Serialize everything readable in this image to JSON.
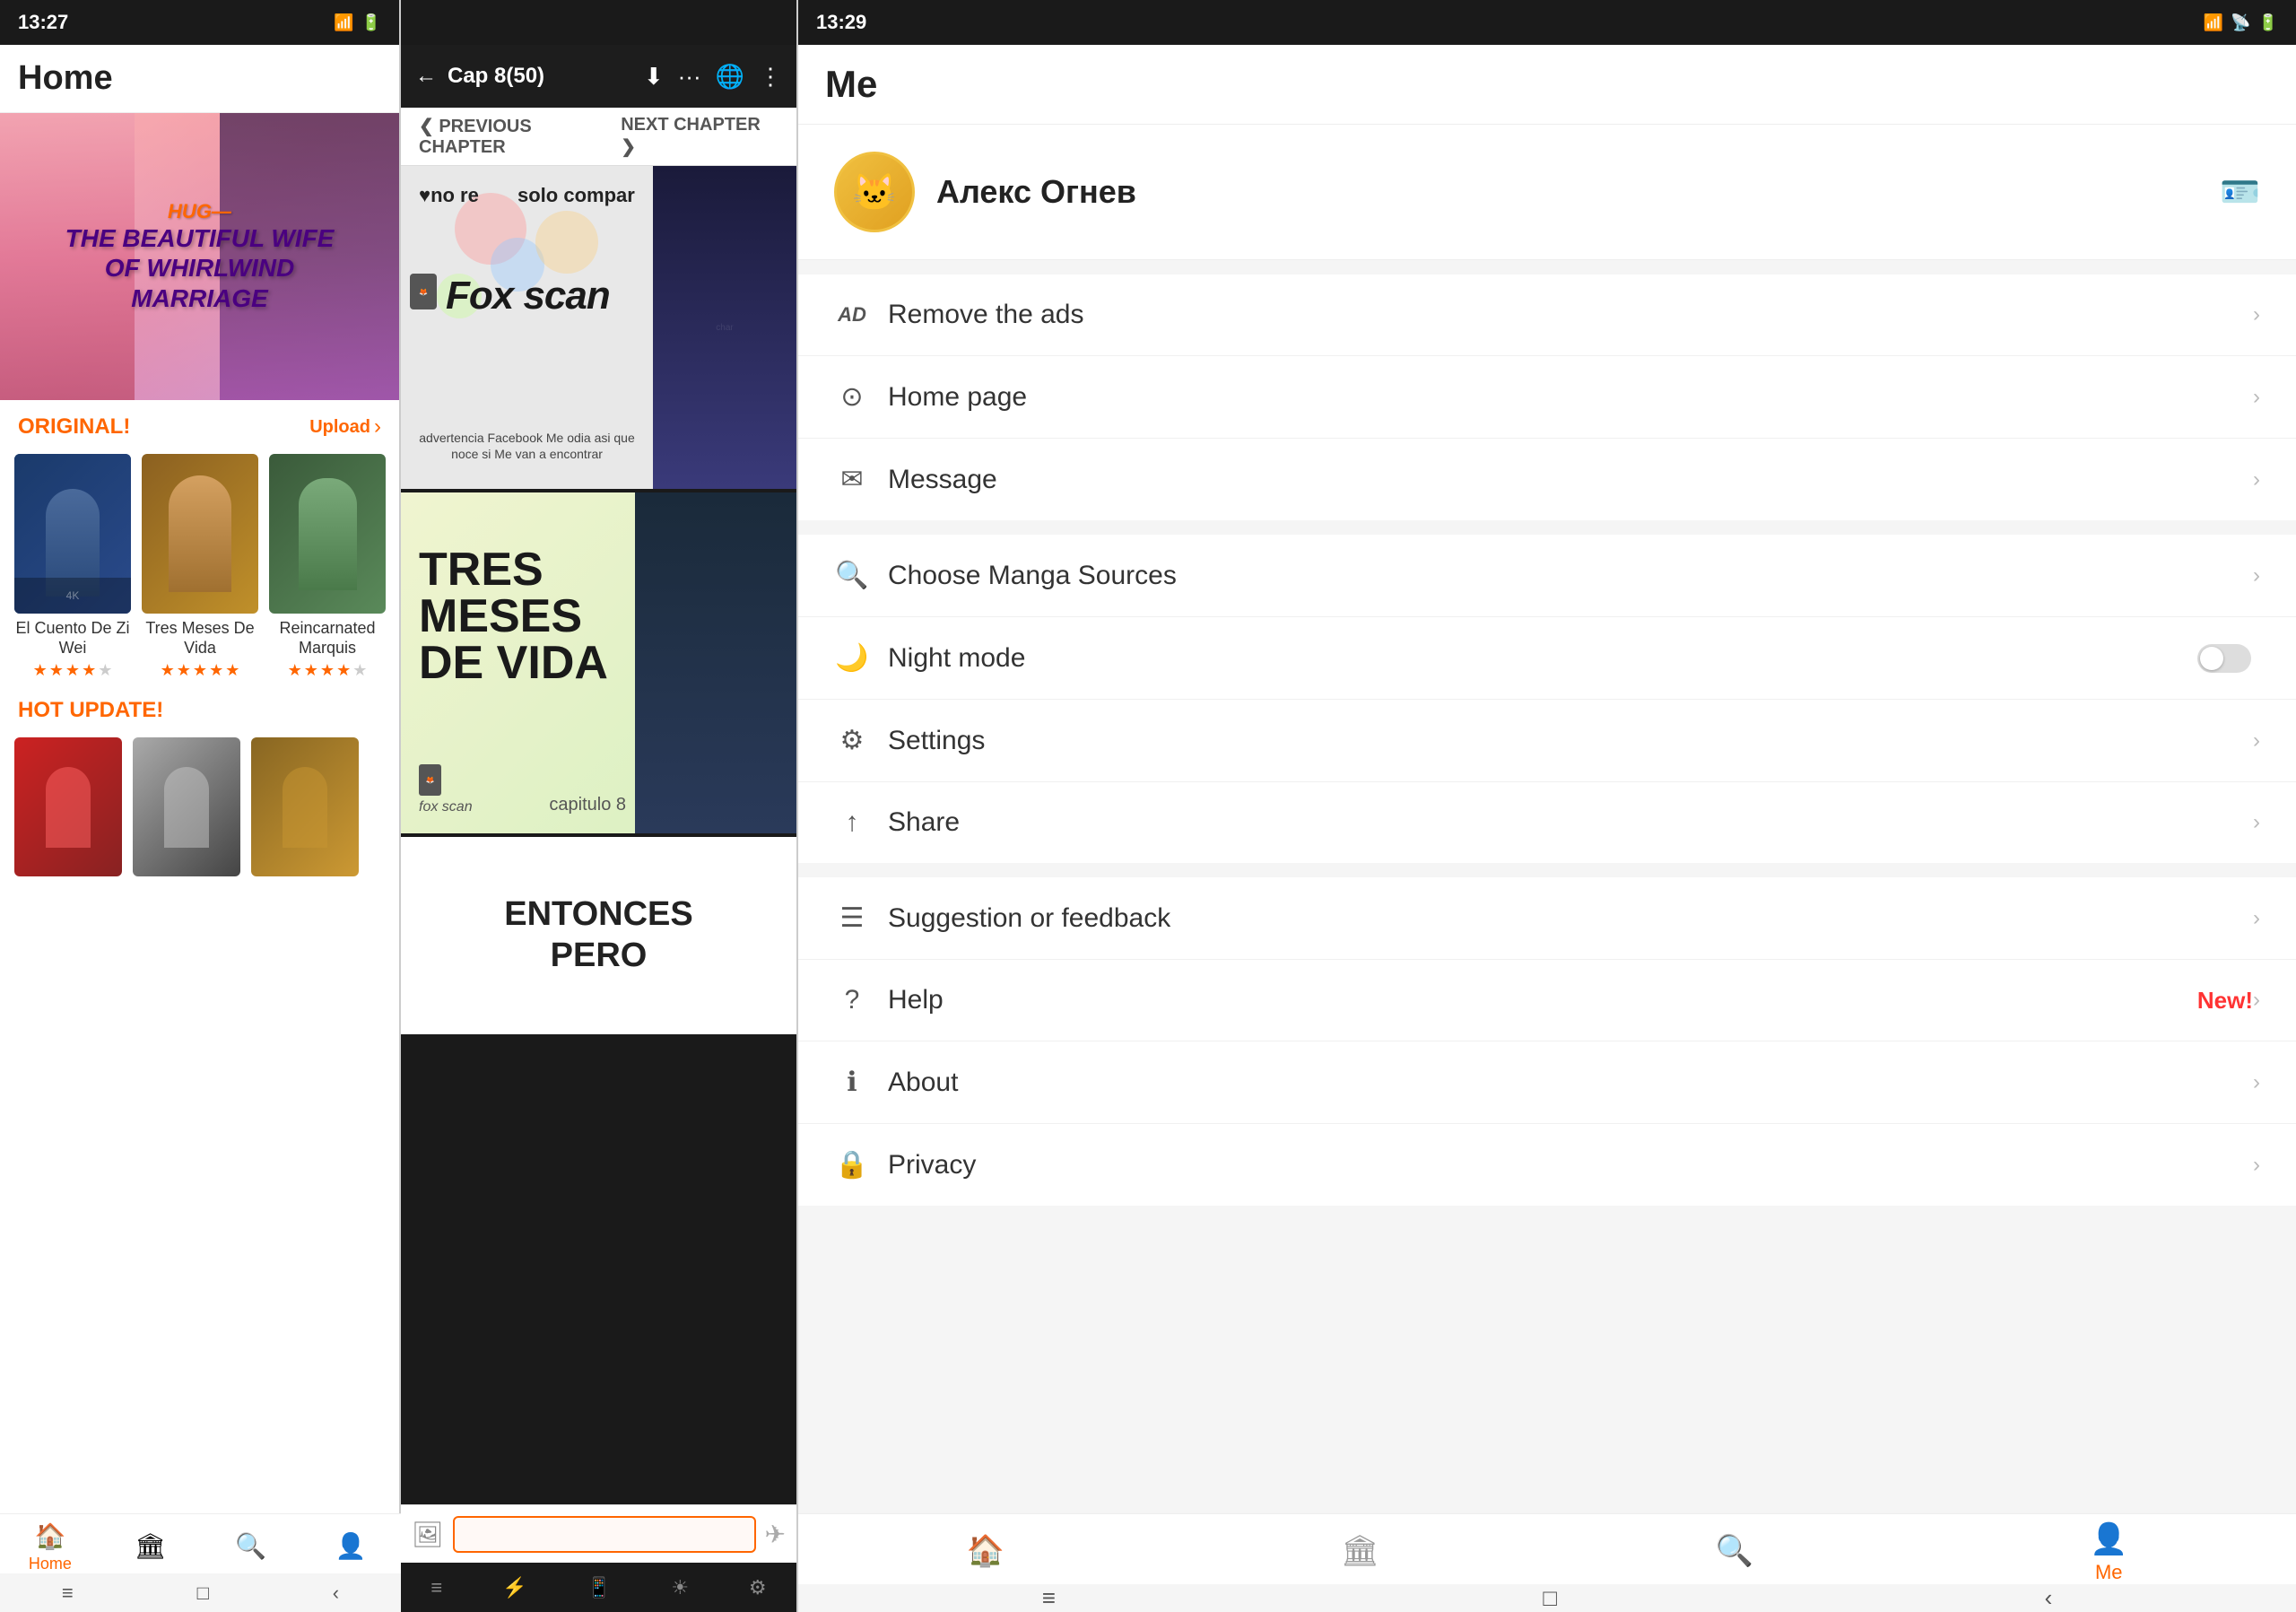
{
  "panels": {
    "home": {
      "statusBar": {
        "time": "13:27",
        "batteryIcon": "🔋",
        "signalIcon": "📶",
        "wifiIcon": "📡"
      },
      "header": {
        "title": "Home"
      },
      "banner": {
        "tagSmall": "HUG—",
        "tagLarge": "THE BEAUTIFUL WIFE\nOF WHIRLWIND\nMARRIAGE"
      },
      "originalSection": {
        "title": "ORIGINAL!",
        "link": "Upload",
        "arrow": "›"
      },
      "mangaItems": [
        {
          "title": "El Cuento De Zi Wei",
          "stars": [
            1,
            1,
            1,
            0.5,
            0
          ],
          "coverClass": "manga-cover-1"
        },
        {
          "title": "Tres Meses De Vida",
          "stars": [
            1,
            1,
            1,
            1,
            1
          ],
          "coverClass": "manga-cover-2"
        },
        {
          "title": "Reincarnated Marquis",
          "stars": [
            1,
            1,
            1,
            0.5,
            0
          ],
          "coverClass": "manga-cover-3"
        }
      ],
      "hotSection": {
        "title": "HOT UPDATE!"
      },
      "bottomNav": [
        {
          "icon": "🏠",
          "label": "Home",
          "active": true
        },
        {
          "icon": "🏛",
          "label": "",
          "active": false
        },
        {
          "icon": "🔍",
          "label": "",
          "active": false
        },
        {
          "icon": "👤",
          "label": "",
          "active": false
        }
      ],
      "sysBar": [
        "≡",
        "□",
        "<"
      ]
    },
    "reader": {
      "statusBar": {
        "time": "",
        "icons": ""
      },
      "toolbar": {
        "backArrow": "← ",
        "chapterTitle": "Cap 8(50)",
        "icons": [
          "⬇",
          "···",
          "🌐",
          "⋮"
        ]
      },
      "chapterNav": {
        "prevLabel": "❮ PREVIOUS CHAPTER",
        "nextLabel": "NEXT CHAPTER ❯"
      },
      "pages": [
        {
          "type": "foxscan_header",
          "topTextLeft": "♥no re",
          "topTextRight": "solo compar",
          "mainText": "Fox scan",
          "subText": "advertencia Facebook Me odia asi que noce si Me van a encontrar"
        },
        {
          "type": "tres_meses",
          "title": "TRES\nMESES\nDE VIDA",
          "logo": "fox scan",
          "capitulo": "capitulo 8"
        },
        {
          "type": "entonces",
          "text": "ENTONCES\nPERO"
        }
      ],
      "bottomBar": {
        "imageIcon": "🖼",
        "inputPlaceholder": "",
        "sendIcon": "✈"
      },
      "sysBar": [
        "≡",
        "⚡",
        "📱",
        "☀",
        "⚙"
      ]
    },
    "me": {
      "statusBar": {
        "time": "13:29",
        "icons": "🔋📶"
      },
      "header": {
        "title": "Me"
      },
      "profile": {
        "avatar": "🐱",
        "username": "Алекс Огнев",
        "profileIcon": "🪪"
      },
      "menuSections": [
        {
          "items": [
            {
              "icon": "AD",
              "iconType": "ad",
              "label": "Remove the ads",
              "type": "arrow"
            },
            {
              "icon": "⊙",
              "label": "Home page",
              "type": "arrow"
            },
            {
              "icon": "✉",
              "label": "Message",
              "type": "arrow"
            }
          ]
        },
        {
          "items": [
            {
              "icon": "🔍",
              "label": "Choose Manga Sources",
              "type": "arrow"
            },
            {
              "icon": "🌙",
              "label": "Night mode",
              "type": "toggle",
              "toggled": false
            },
            {
              "icon": "⚙",
              "label": "Settings",
              "type": "arrow"
            },
            {
              "icon": "↑",
              "label": "Share",
              "type": "arrow"
            }
          ]
        },
        {
          "items": [
            {
              "icon": "☰",
              "label": "Suggestion or feedback",
              "type": "arrow"
            },
            {
              "icon": "?",
              "label": "Help",
              "badge": "New!",
              "type": "arrow"
            },
            {
              "icon": "ℹ",
              "label": "About",
              "type": "arrow"
            },
            {
              "icon": "🔒",
              "label": "Privacy",
              "type": "arrow"
            }
          ]
        }
      ],
      "bottomNav": [
        {
          "icon": "🏠",
          "label": "",
          "active": false
        },
        {
          "icon": "🏛",
          "label": "",
          "active": false
        },
        {
          "icon": "🔍",
          "label": "",
          "active": false
        },
        {
          "icon": "👤",
          "label": "Me",
          "active": true
        }
      ],
      "sysBar": [
        "≡",
        "□",
        "<"
      ]
    }
  }
}
